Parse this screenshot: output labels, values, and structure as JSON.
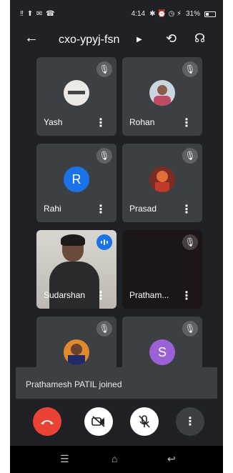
{
  "status_bar": {
    "left_icons": "‼ ⬆ ✉ ☎",
    "time": "4:14",
    "right_icons": "✱ ⏰ ◷ ⚡",
    "battery": "31%"
  },
  "header": {
    "meeting_code": "cxo-ypyj-fsn"
  },
  "participants": [
    {
      "name": "Yash",
      "state": "muted"
    },
    {
      "name": "Rohan",
      "state": "muted"
    },
    {
      "name": "Rahi",
      "initial": "R",
      "avatar_color": "#1a73e8",
      "state": "muted"
    },
    {
      "name": "Prasad",
      "state": "muted"
    },
    {
      "name": "Sudarshan",
      "state": "speaking"
    },
    {
      "name": "Pratham...",
      "state": "muted"
    },
    {
      "name": "",
      "state": "muted"
    },
    {
      "name": "",
      "initial": "S",
      "avatar_color": "#9b62d8",
      "state": "muted"
    }
  ],
  "toast": {
    "message": "Prathamesh PATIL joined"
  },
  "colors": {
    "end_call": "#ea4335",
    "background": "#202124",
    "speaking": "#1a73e8"
  }
}
